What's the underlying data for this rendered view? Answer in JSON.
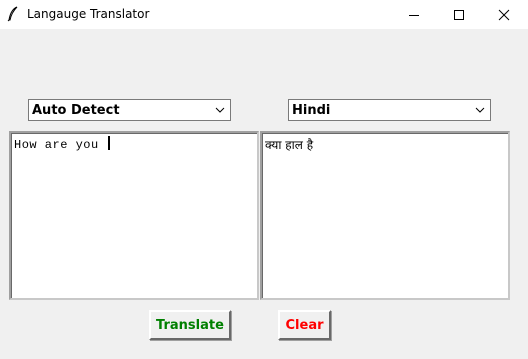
{
  "window": {
    "title": "Langauge Translator",
    "icons": {
      "app": "feather-icon",
      "minimize": "minimize-icon",
      "maximize": "maximize-icon",
      "close": "close-icon"
    }
  },
  "source_language": {
    "selected": "Auto Detect"
  },
  "target_language": {
    "selected": "Hindi"
  },
  "input_text": "How are you ",
  "output_text": "क्या हाल है",
  "buttons": {
    "translate": {
      "label": "Translate",
      "color": "#008000"
    },
    "clear": {
      "label": "Clear",
      "color": "#ff0000"
    }
  }
}
